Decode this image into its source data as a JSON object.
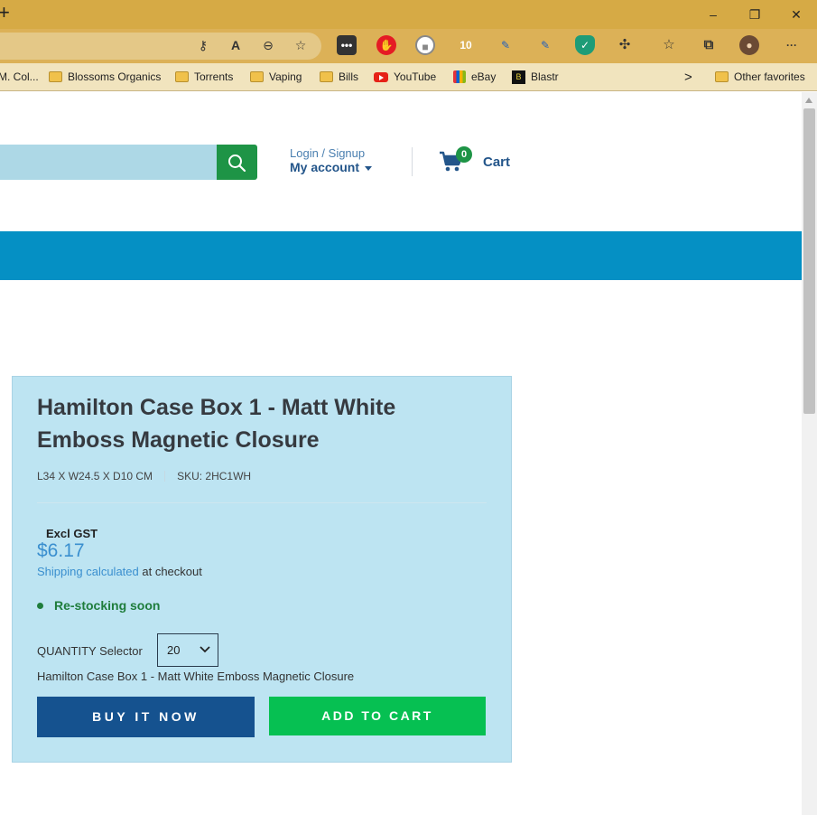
{
  "browser": {
    "window_controls": {
      "minimize": "–",
      "restore": "❐",
      "close": "✕"
    },
    "new_tab_glyph": "+",
    "extensions": {
      "badge_count": "10"
    },
    "bookmarks": [
      {
        "label": "M. Col...",
        "icon": "truncated"
      },
      {
        "label": "Blossoms Organics",
        "icon": "folder-icon"
      },
      {
        "label": "Torrents",
        "icon": "folder-icon"
      },
      {
        "label": "Vaping",
        "icon": "folder-icon"
      },
      {
        "label": "Bills",
        "icon": "folder-icon"
      },
      {
        "label": "YouTube",
        "icon": "youtube-icon"
      },
      {
        "label": "eBay",
        "icon": "ebay-icon"
      },
      {
        "label": "Blastr",
        "icon": "blastr-icon"
      }
    ],
    "other_favorites": "Other favorites",
    "overflow_chevron": ">"
  },
  "header": {
    "login_signup": "Login / Signup",
    "my_account": "My account",
    "cart_count": "0",
    "cart_label": "Cart"
  },
  "product": {
    "title": "Hamilton Case Box 1 - Matt White Emboss Magnetic Closure",
    "dimensions": "L34 X W24.5 X D10 CM",
    "sku": "SKU: 2HC1WH",
    "tax_label": "Excl GST",
    "price": "$6.17",
    "shipping_link": "Shipping calculated",
    "shipping_suffix": "at checkout",
    "stock_status": "Re-stocking soon",
    "quantity_label": "QUANTITY Selector",
    "quantity_value": "20",
    "variant_name": "Hamilton Case Box 1 - Matt White Emboss Magnetic Closure",
    "buy_now": "BUY IT NOW",
    "add_to_cart": "ADD TO CART"
  },
  "colors": {
    "accent_blue": "#0590c4",
    "search_green": "#1e9446",
    "buy_button": "#15528f",
    "add_button": "#06c052",
    "card_bg": "#bde4f2"
  }
}
